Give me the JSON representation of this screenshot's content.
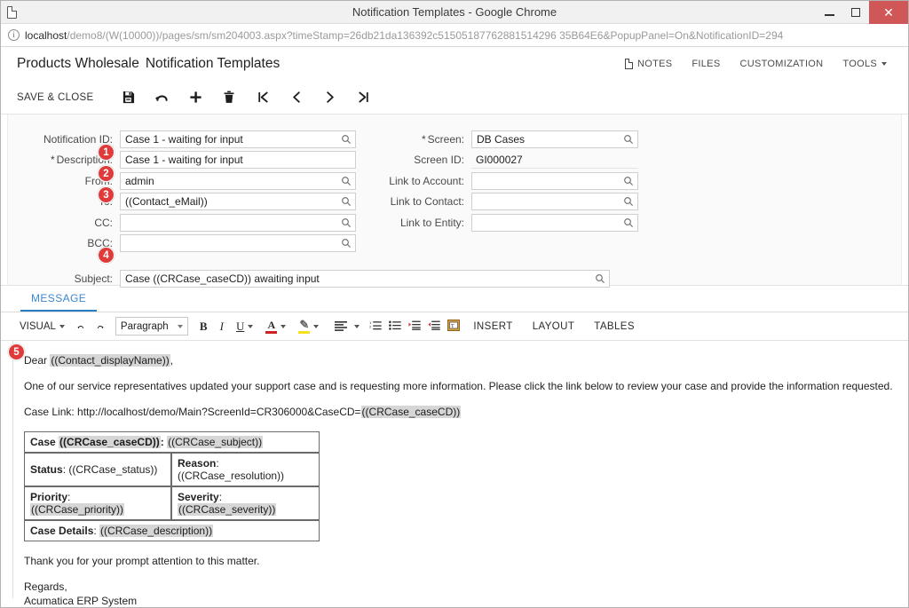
{
  "browser": {
    "window_title": "Notification Templates - Google Chrome",
    "favicon": "page-icon",
    "minimize_label": "–",
    "maximize_label": "⬜",
    "close_label": "✕",
    "url_host": "localhost",
    "url_rest": "/demo8/(W(10000))/pages/sm/sm204003.aspx?timeStamp=26db21da136392c51505187762881514296 35B64E6&PopupPanel=On&NotificationID=294",
    "url_full": "localhost/demo8/(W(10000))/pages/sm/sm204003.aspx?timeStamp=26db21da136392c515051877628815142 9635B64E6&PopupPanel=On&NotificationID=294",
    "info_icon": "info-icon"
  },
  "header": {
    "org_title": "Products Wholesale",
    "screen_title": "Notification Templates",
    "notes": "NOTES",
    "files": "FILES",
    "customization": "CUSTOMIZATION",
    "tools": "TOOLS"
  },
  "toolbar": {
    "save_close": "SAVE & CLOSE",
    "buttons": [
      {
        "name": "save-button",
        "icon": "floppy-disk-icon"
      },
      {
        "name": "undo-button",
        "icon": "undo-arrow-icon"
      },
      {
        "name": "add-new-button",
        "icon": "plus-icon"
      },
      {
        "name": "delete-button",
        "icon": "trash-icon"
      },
      {
        "name": "first-record-button",
        "icon": "first-page-icon"
      },
      {
        "name": "previous-record-button",
        "icon": "chevron-left-icon"
      },
      {
        "name": "next-record-button",
        "icon": "chevron-right-icon"
      },
      {
        "name": "last-record-button",
        "icon": "last-page-icon"
      }
    ]
  },
  "form": {
    "left": [
      {
        "label": "Notification ID:",
        "value": "Case 1 - waiting for input",
        "required": false,
        "lens": true,
        "badge": null
      },
      {
        "label": "Description:",
        "value": "Case 1 - waiting for input",
        "required": true,
        "lens": false,
        "badge": "1"
      },
      {
        "label": "From:",
        "value": "admin",
        "required": false,
        "lens": true,
        "badge": "2"
      },
      {
        "label": "To:",
        "value": "((Contact_eMail))",
        "required": false,
        "lens": true,
        "badge": "3"
      },
      {
        "label": "CC:",
        "value": "",
        "required": false,
        "lens": true,
        "badge": null
      },
      {
        "label": "BCC:",
        "value": "",
        "required": false,
        "lens": true,
        "badge": null
      }
    ],
    "subject": {
      "label": "Subject:",
      "value": "Case ((CRCase_caseCD)) awaiting input",
      "badge": "4",
      "lens": true
    },
    "right": [
      {
        "label": "Screen:",
        "value": "DB Cases",
        "required": true,
        "lens": true,
        "static": false
      },
      {
        "label": "Screen ID:",
        "value": "GI000027",
        "required": false,
        "lens": false,
        "static": true
      },
      {
        "label": "Link to Account:",
        "value": "",
        "required": false,
        "lens": true,
        "static": false
      },
      {
        "label": "Link to Contact:",
        "value": "",
        "required": false,
        "lens": true,
        "static": false
      },
      {
        "label": "Link to Entity:",
        "value": "",
        "required": false,
        "lens": true,
        "static": false
      }
    ]
  },
  "tabs": [
    {
      "label": "MESSAGE",
      "active": true
    }
  ],
  "editor_toolbar": {
    "mode": "VISUAL",
    "undo": "undo-arrow-icon",
    "redo": "redo-arrow-icon",
    "paragraph_style": "Paragraph",
    "bold": "B",
    "italic": "I",
    "underline": "U",
    "font_color_glyph": "A",
    "font_color": "#cc2222",
    "highlight_glyph": "✎",
    "highlight_color": "#f5e11e",
    "align_icon": "align-icon",
    "ordered_list_icon": "numbered-list-icon",
    "bullet_list_icon": "bullet-list-icon",
    "indent_increase_icon": "indent-increase-icon",
    "indent_decrease_icon": "indent-decrease-icon",
    "insert_field_icon": "insert-field-icon",
    "insert": "INSERT",
    "layout": "LAYOUT",
    "tables": "TABLES"
  },
  "message": {
    "badge": "5",
    "greeting_pre": "Dear ",
    "greeting_token": "((Contact_displayName))",
    "greeting_post": ",",
    "paragraph": "One of our service representatives updated your support case and is requesting more information. Please click the link below to review your case and provide the information requested.",
    "case_link_pre": "Case Link: http://localhost/demo/Main?ScreenId=CR306000&CaseCD=",
    "case_link_token": "((CRCase_caseCD))",
    "table": {
      "row1_label": "Case ",
      "row1_token1": "((CRCase_caseCD))",
      "row1_mid": ": ",
      "row1_token2": "((CRCase_subject))",
      "row2_l_label": "Status",
      "row2_l_sep": ": ",
      "row2_l_token": "((CRCase_status))",
      "row2_r_label": "Reason",
      "row2_r_sep": ": ",
      "row2_r_token": "((CRCase_resolution))",
      "row3_l_label": "Priority",
      "row3_l_sep": ": ",
      "row3_l_token": "((CRCase_priority))",
      "row3_r_label": "Severity",
      "row3_r_sep": ": ",
      "row3_r_token": "((CRCase_severity))",
      "row4_label": "Case Details",
      "row4_sep": ": ",
      "row4_token": "((CRCase_description))"
    },
    "closing": "Thank you for your prompt attention to this matter.",
    "regards": "Regards,",
    "signature": "Acumatica ERP System"
  },
  "colors": {
    "accent_blue": "#2a7ec4",
    "badge_red": "#e03b3b",
    "close_red": "#cf5757",
    "token_gray": "#d6d6d6"
  }
}
